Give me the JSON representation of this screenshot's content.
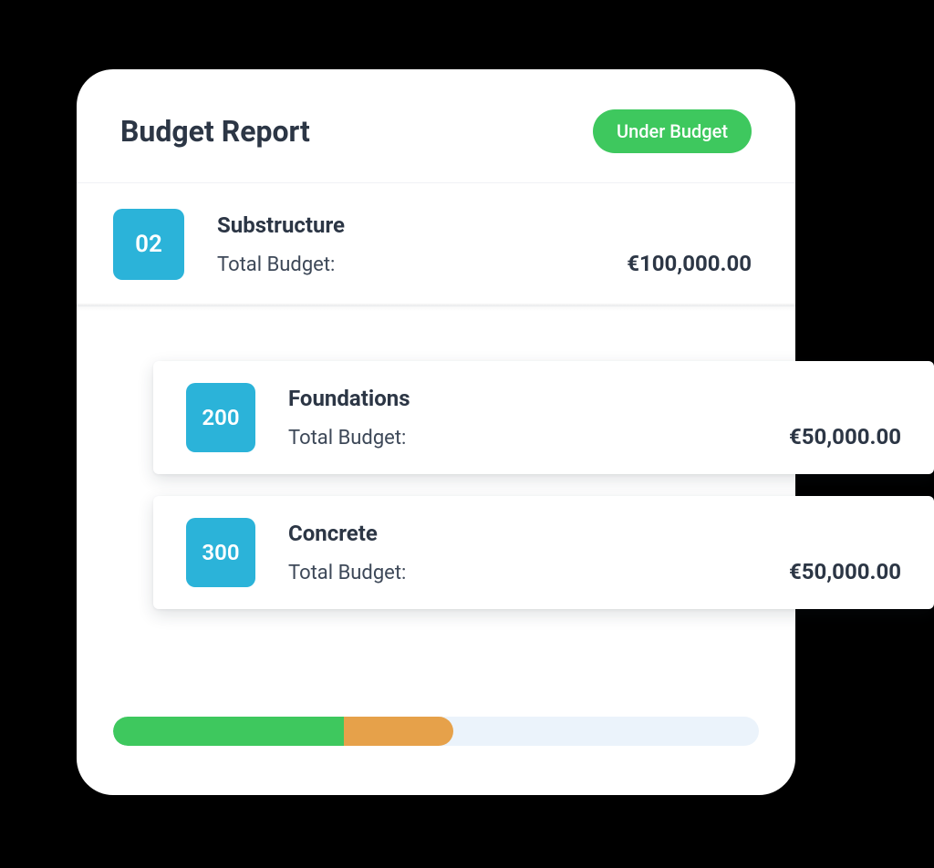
{
  "header": {
    "title": "Budget Report",
    "status_label": "Under Budget"
  },
  "section": {
    "code": "02",
    "name": "Substructure",
    "budget_label": "Total Budget:",
    "budget_value": "€100,000.00"
  },
  "sub_items": [
    {
      "code": "200",
      "name": "Foundations",
      "budget_label": "Total Budget:",
      "budget_value": "€50,000.00"
    },
    {
      "code": "300",
      "name": "Concrete",
      "budget_label": "Total Budget:",
      "budget_value": "€50,000.00"
    }
  ],
  "progress": {
    "green_pct": 38,
    "orange_pct": 15
  },
  "colors": {
    "accent": "#2bb3d9",
    "success": "#3ec85e",
    "warning": "#e6a14a",
    "track": "#ebf3fb",
    "text": "#2c3645"
  }
}
